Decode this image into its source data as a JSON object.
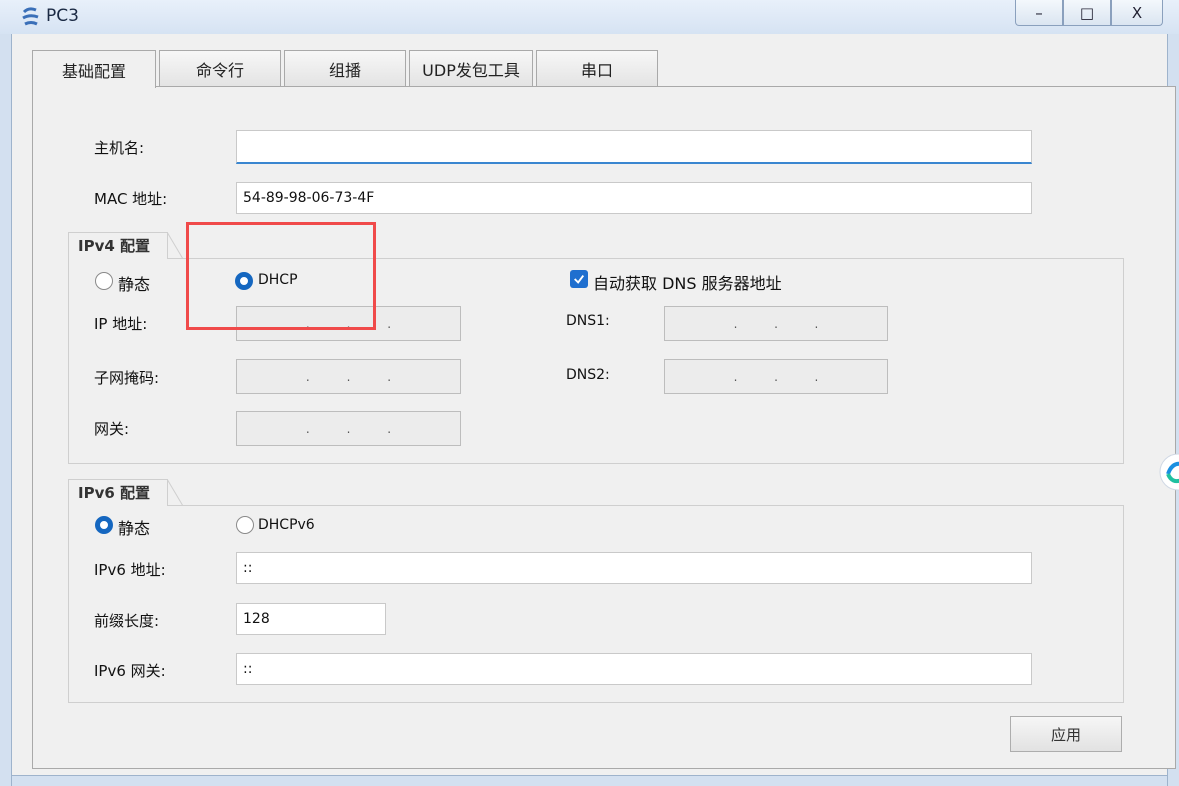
{
  "window": {
    "title": "PC3",
    "min_label": "–",
    "max_label": "□",
    "close_label": "X"
  },
  "tabs": [
    {
      "label": "基础配置",
      "active": true
    },
    {
      "label": "命令行",
      "active": false
    },
    {
      "label": "组播",
      "active": false
    },
    {
      "label": "UDP发包工具",
      "active": false
    },
    {
      "label": "串口",
      "active": false
    }
  ],
  "host": {
    "label": "主机名:",
    "value": ""
  },
  "mac": {
    "label": "MAC 地址:",
    "value": "54-89-98-06-73-4F"
  },
  "ipv4": {
    "title": "IPv4 配置",
    "static_label": "静态",
    "dhcp_label": "DHCP",
    "selected": "DHCP",
    "auto_dns_label": "自动获取 DNS 服务器地址",
    "auto_dns_checked": true,
    "ip_label": "IP 地址:",
    "mask_label": "子网掩码:",
    "gateway_label": "网关:",
    "dns1_label": "DNS1:",
    "dns2_label": "DNS2:",
    "dot": "."
  },
  "ipv6": {
    "title": "IPv6 配置",
    "static_label": "静态",
    "dhcp_label": "DHCPv6",
    "selected": "静态",
    "addr_label": "IPv6 地址:",
    "addr_value": "::",
    "prefix_label": "前缀长度:",
    "prefix_value": "128",
    "gateway_label": "IPv6 网关:",
    "gateway_value": "::"
  },
  "apply_label": "应用",
  "colors": {
    "accent": "#1567c0",
    "highlight": "#f04a4a"
  }
}
